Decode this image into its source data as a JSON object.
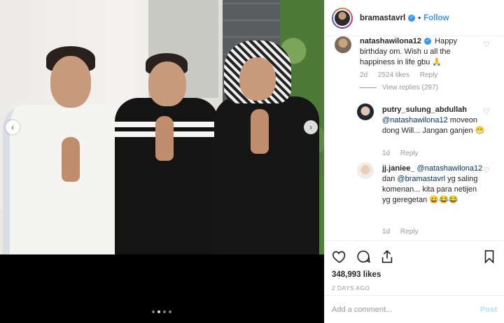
{
  "post": {
    "username": "bramastavrl",
    "separator": "•",
    "follow_label": "Follow",
    "verified_mark": "✓"
  },
  "carousel": {
    "prev_arrow": "‹",
    "next_arrow": "›",
    "slide_count": 4,
    "active_slide": 2
  },
  "comments": [
    {
      "username": "natashawilona12",
      "verified": true,
      "text": "Happy birthday om. Wish u all the happiness in life gbu 🙏",
      "age": "2d",
      "likes": "2524 likes",
      "reply_label": "Reply",
      "view_replies": "View replies (297)"
    },
    {
      "username": "putry_sulung_abdullah",
      "mention": "@natashawilona12",
      "text": "moveon dong Will... Jangan ganjen 😁",
      "age": "1d",
      "reply_label": "Reply"
    },
    {
      "username": "jj.janiee_",
      "mention": "@natashawilona12",
      "mid_text": "dan",
      "mention2": "@bramastavrl",
      "text": "yg saling komenan... kita para netijen yg geregetan 😄😂😂",
      "age": "1d",
      "reply_label": "Reply"
    }
  ],
  "actions": {
    "like_icon": "heart-icon",
    "comment_icon": "comment-icon",
    "share_icon": "share-icon",
    "save_icon": "bookmark-icon",
    "likes": "348,993 likes",
    "age": "2 DAYS AGO"
  },
  "composer": {
    "placeholder": "Add a comment...",
    "post_label": "Post"
  },
  "colors": {
    "link": "#3897f0",
    "post_disabled": "#b2dffc",
    "muted": "#999999",
    "text": "#262626"
  }
}
